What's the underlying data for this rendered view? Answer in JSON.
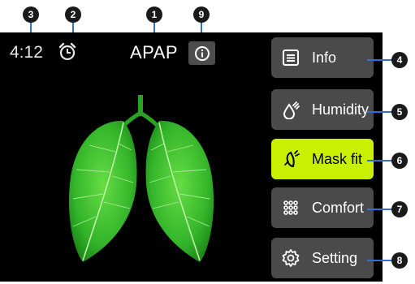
{
  "status": {
    "time": "4:12",
    "mode": "APAP"
  },
  "menu": [
    {
      "label": "Info",
      "icon": "list-icon",
      "active": false
    },
    {
      "label": "Humidity",
      "icon": "humidity-icon",
      "active": false
    },
    {
      "label": "Mask fit",
      "icon": "mask-fit-icon",
      "active": true
    },
    {
      "label": "Comfort",
      "icon": "grid-dots-icon",
      "active": false
    },
    {
      "label": "Setting",
      "icon": "gear-icon",
      "active": false
    }
  ],
  "callouts": {
    "mode": "1",
    "alarm": "2",
    "time": "3",
    "info": "4",
    "humidity": "5",
    "mask_fit": "6",
    "comfort": "7",
    "setting": "8",
    "info_button": "9"
  },
  "colors": {
    "screen_bg": "#000000",
    "button_bg": "#4a4a4a",
    "active_bg": "#c8f000",
    "leader": "#2f6fd6",
    "leaf": "#3fbf2f"
  }
}
